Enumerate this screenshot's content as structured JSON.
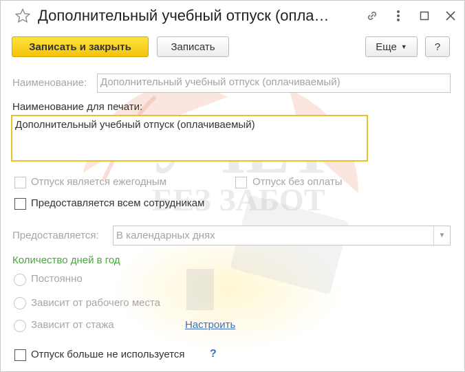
{
  "window": {
    "title": "Дополнительный учебный отпуск (опла…"
  },
  "toolbar": {
    "save_close_label": "Записать и закрыть",
    "save_label": "Записать",
    "more_label": "Еще",
    "help_label": "?"
  },
  "form": {
    "name_label": "Наименование:",
    "name_value": "Дополнительный учебный отпуск (оплачиваемый)",
    "print_name_label": "Наименование для печати:",
    "print_name_value": "Дополнительный учебный отпуск (оплачиваемый)",
    "annual_label": "Отпуск является ежегодным",
    "unpaid_label": "Отпуск без оплаты",
    "all_employees_label": "Предоставляется всем сотрудникам",
    "provided_label": "Предоставляется:",
    "provided_value": "В календарных днях",
    "days_section_title": "Количество дней в год",
    "radio_constant": "Постоянно",
    "radio_workplace": "Зависит от рабочего места",
    "radio_seniority": "Зависит от стажа",
    "configure_link": "Настроить",
    "not_used_label": "Отпуск больше не используется",
    "not_used_help": "?"
  },
  "watermark": {
    "line1": "УЧЕТ",
    "line2": "БЕЗ ЗАБОТ"
  },
  "colors": {
    "primary_button": "#f4c20d",
    "section_title": "#4aa53f",
    "link": "#3e6eb8",
    "focus_border": "#e5c32d"
  }
}
